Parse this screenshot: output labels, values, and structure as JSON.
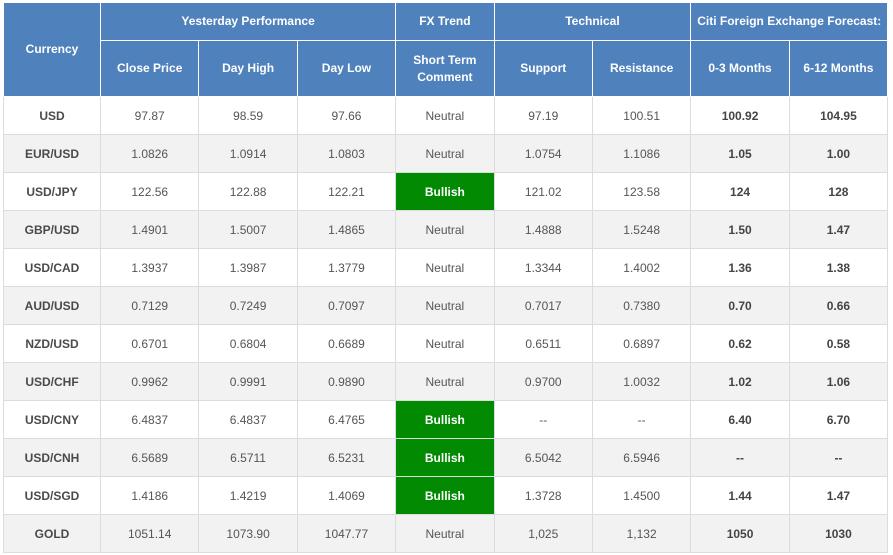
{
  "header": {
    "currency": "Currency",
    "groups": {
      "yesterday": "Yesterday Performance",
      "fx_trend": "FX Trend",
      "technical": "Technical",
      "forecast": "Citi Foreign Exchange Forecast:"
    },
    "columns": {
      "close": "Close Price",
      "high": "Day High",
      "low": "Day Low",
      "trend": "Short Term Comment",
      "support": "Support",
      "resistance": "Resistance",
      "f03": "0-3 Months",
      "f612": "6-12 Months"
    }
  },
  "rows": [
    {
      "currency": "USD",
      "close": "97.87",
      "high": "98.59",
      "low": "97.66",
      "trend": "Neutral",
      "support": "97.19",
      "resistance": "100.51",
      "f03": "100.92",
      "f612": "104.95"
    },
    {
      "currency": "EUR/USD",
      "close": "1.0826",
      "high": "1.0914",
      "low": "1.0803",
      "trend": "Neutral",
      "support": "1.0754",
      "resistance": "1.1086",
      "f03": "1.05",
      "f612": "1.00"
    },
    {
      "currency": "USD/JPY",
      "close": "122.56",
      "high": "122.88",
      "low": "122.21",
      "trend": "Bullish",
      "support": "121.02",
      "resistance": "123.58",
      "f03": "124",
      "f612": "128"
    },
    {
      "currency": "GBP/USD",
      "close": "1.4901",
      "high": "1.5007",
      "low": "1.4865",
      "trend": "Neutral",
      "support": "1.4888",
      "resistance": "1.5248",
      "f03": "1.50",
      "f612": "1.47"
    },
    {
      "currency": "USD/CAD",
      "close": "1.3937",
      "high": "1.3987",
      "low": "1.3779",
      "trend": "Neutral",
      "support": "1.3344",
      "resistance": "1.4002",
      "f03": "1.36",
      "f612": "1.38"
    },
    {
      "currency": "AUD/USD",
      "close": "0.7129",
      "high": "0.7249",
      "low": "0.7097",
      "trend": "Neutral",
      "support": "0.7017",
      "resistance": "0.7380",
      "f03": "0.70",
      "f612": "0.66"
    },
    {
      "currency": "NZD/USD",
      "close": "0.6701",
      "high": "0.6804",
      "low": "0.6689",
      "trend": "Neutral",
      "support": "0.6511",
      "resistance": "0.6897",
      "f03": "0.62",
      "f612": "0.58"
    },
    {
      "currency": "USD/CHF",
      "close": "0.9962",
      "high": "0.9991",
      "low": "0.9890",
      "trend": "Neutral",
      "support": "0.9700",
      "resistance": "1.0032",
      "f03": "1.02",
      "f612": "1.06"
    },
    {
      "currency": "USD/CNY",
      "close": "6.4837",
      "high": "6.4837",
      "low": "6.4765",
      "trend": "Bullish",
      "support": "--",
      "resistance": "--",
      "f03": "6.40",
      "f612": "6.70"
    },
    {
      "currency": "USD/CNH",
      "close": "6.5689",
      "high": "6.5711",
      "low": "6.5231",
      "trend": "Bullish",
      "support": "6.5042",
      "resistance": "6.5946",
      "f03": "--",
      "f612": "--"
    },
    {
      "currency": "USD/SGD",
      "close": "1.4186",
      "high": "1.4219",
      "low": "1.4069",
      "trend": "Bullish",
      "support": "1.3728",
      "resistance": "1.4500",
      "f03": "1.44",
      "f612": "1.47"
    },
    {
      "currency": "GOLD",
      "close": "1051.14",
      "high": "1073.90",
      "low": "1047.77",
      "trend": "Neutral",
      "support": "1,025",
      "resistance": "1,132",
      "f03": "1050",
      "f612": "1030"
    }
  ],
  "colors": {
    "header_bg": "#4f81bd",
    "bullish_bg": "#028a02"
  }
}
